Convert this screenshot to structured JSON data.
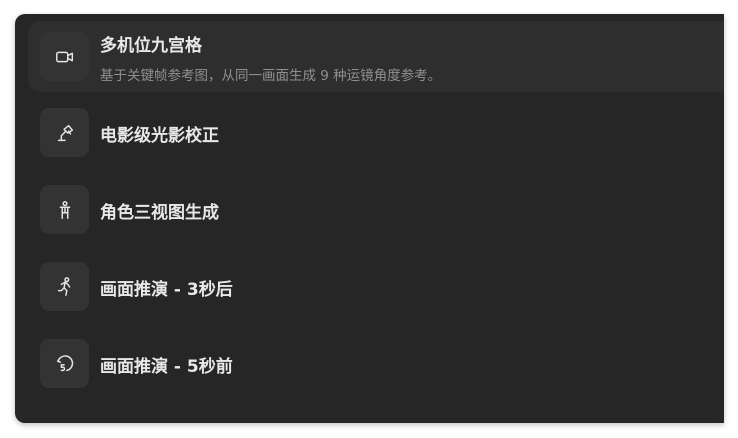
{
  "menu": {
    "items": [
      {
        "title": "多机位九宫格",
        "description": "基于关键帧参考图，从同一画面生成 9 种运镜角度参考。",
        "icon": "video-camera-icon",
        "active": true
      },
      {
        "title": "电影级光影校正",
        "icon": "lamp-icon",
        "active": false
      },
      {
        "title": "角色三视图生成",
        "icon": "person-icon",
        "active": false
      },
      {
        "title": "画面推演 - 3秒后",
        "icon": "running-person-icon",
        "active": false
      },
      {
        "title": "画面推演 - 5秒前",
        "icon": "rewind-5-icon",
        "active": false
      }
    ]
  },
  "colors": {
    "panel_bg": "#262626",
    "active_item_bg": "#2e2e2e",
    "icon_box_bg": "#333333",
    "title_text": "#e8e8e8",
    "desc_text": "#8f8f8f"
  }
}
